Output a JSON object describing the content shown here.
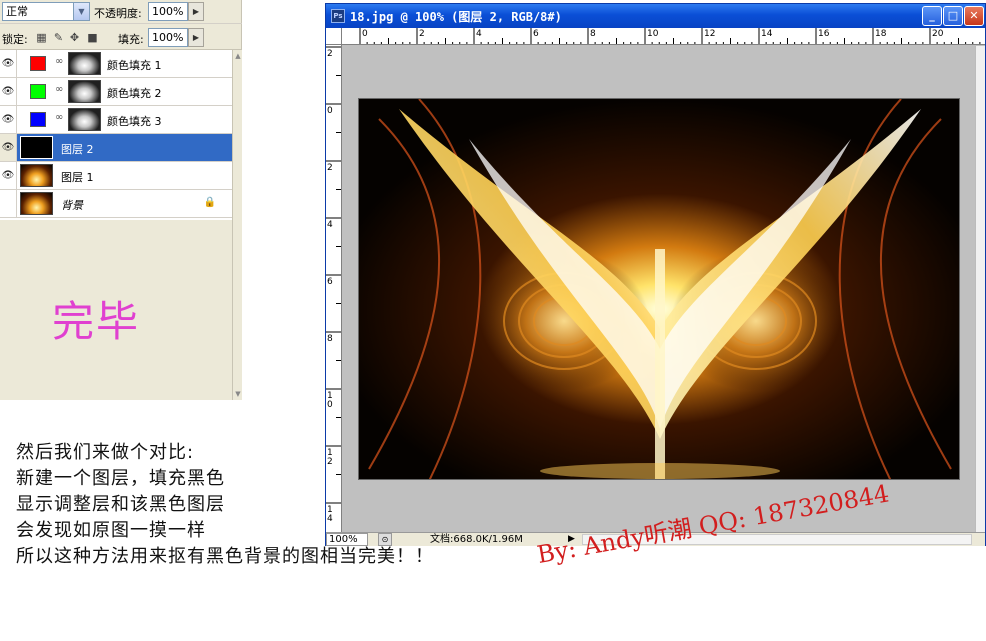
{
  "layers_panel": {
    "blend_mode": "正常",
    "opacity_label": "不透明度:",
    "opacity_value": "100%",
    "lock_label": "锁定:",
    "fill_label": "填充:",
    "fill_value": "100%",
    "layers": [
      {
        "name": "颜色填充 1",
        "swatch": "#ff0000",
        "kind": "fill",
        "visible": true,
        "selected": false
      },
      {
        "name": "颜色填充 2",
        "swatch": "#00ff00",
        "kind": "fill",
        "visible": true,
        "selected": false
      },
      {
        "name": "颜色填充 3",
        "swatch": "#0000ff",
        "kind": "fill",
        "visible": true,
        "selected": false
      },
      {
        "name": "图层 2",
        "kind": "pixel-black",
        "visible": true,
        "selected": true
      },
      {
        "name": "图层 1",
        "kind": "pixel-image",
        "visible": true,
        "selected": false
      },
      {
        "name": "背景",
        "kind": "background",
        "visible": false,
        "selected": false,
        "locked": true
      }
    ]
  },
  "done_text": "完毕",
  "document": {
    "title": "18.jpg @ 100% (图层 2, RGB/8#)",
    "ruler_h_labels": [
      "0",
      "2",
      "4",
      "6",
      "8",
      "10",
      "12",
      "14",
      "16",
      "18",
      "20"
    ],
    "ruler_v_labels": [
      "2",
      "0",
      "2",
      "4",
      "6",
      "8",
      "10",
      "12",
      "14"
    ],
    "status_zoom": "100%",
    "status_info": "文档:668.0K/1.96M",
    "buttons": {
      "minimize": "_",
      "maximize": "□",
      "close": "✕"
    }
  },
  "notes": [
    "然后我们来做个对比:",
    "新建一个图层，填充黑色",
    "显示调整层和该黑色图层",
    "会发现如原图一摸一样",
    "所以这种方法用来抠有黑色背景的图相当完美！！"
  ],
  "signature": "By:  Andy听潮     QQ:  187320844",
  "colors": {
    "selection": "#316ac5",
    "title_bar": "#0a4fd6",
    "done_text": "#e040d0",
    "signature": "#d21e1e"
  }
}
